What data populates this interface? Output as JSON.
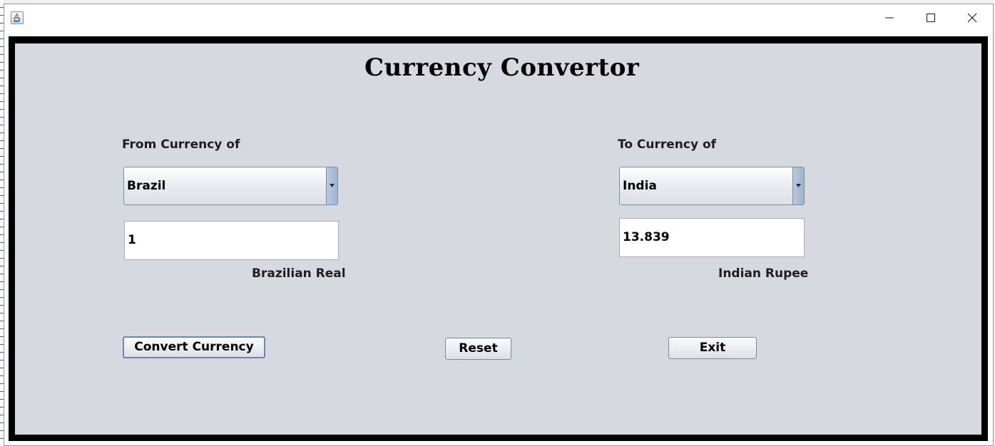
{
  "window": {
    "title_text": ""
  },
  "app": {
    "title": "Currency Convertor",
    "from": {
      "label": "From Currency of",
      "selected_country": "Brazil",
      "amount": "1",
      "currency_name": "Brazilian Real"
    },
    "to": {
      "label": "To Currency of",
      "selected_country": "India",
      "amount": "13.839",
      "currency_name": "Indian Rupee"
    },
    "buttons": {
      "convert_label": "Convert Currency",
      "reset_label": "Reset",
      "exit_label": "Exit"
    }
  },
  "colors": {
    "content_background": "#d6d9e0",
    "frame_border": "#000000"
  },
  "icons": {
    "app": "java-coffee-cup-icon",
    "minimize": "minimize-icon",
    "maximize": "maximize-icon",
    "close": "close-icon",
    "dropdown": "chevron-down-icon"
  }
}
